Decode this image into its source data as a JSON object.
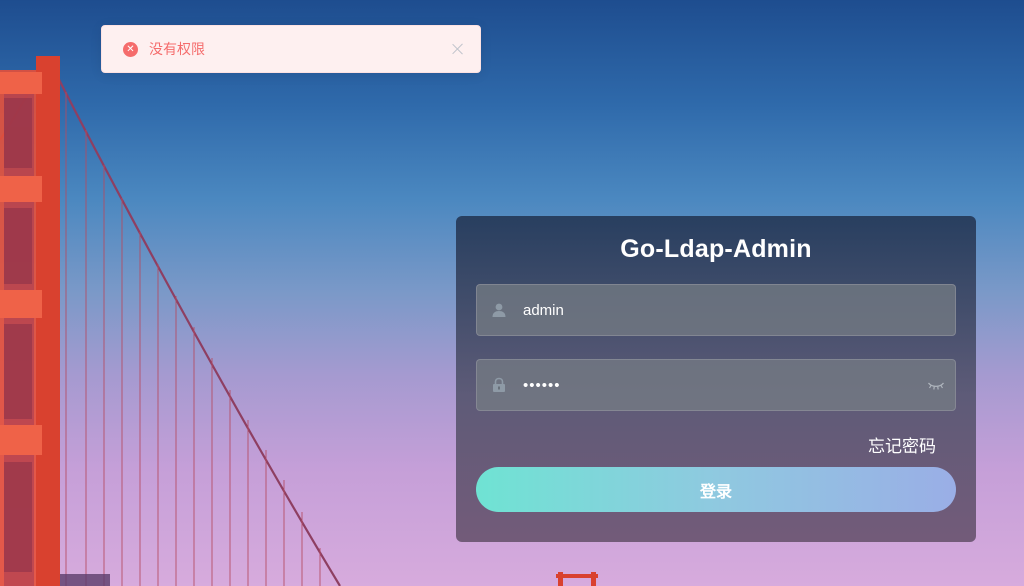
{
  "toast": {
    "message": "没有权限",
    "type": "error",
    "icon": "error-circle-icon",
    "color": "#f56c6c"
  },
  "login": {
    "title": "Go-Ldap-Admin",
    "username": {
      "value": "admin",
      "icon": "user-icon"
    },
    "password": {
      "value": "••••••",
      "icon": "lock-icon",
      "toggle_icon": "eye-closed-icon"
    },
    "forgot_label": "忘记密码",
    "submit_label": "登录"
  },
  "background": {
    "scene": "golden-gate-bridge",
    "bridge_color": "#e0473a"
  }
}
